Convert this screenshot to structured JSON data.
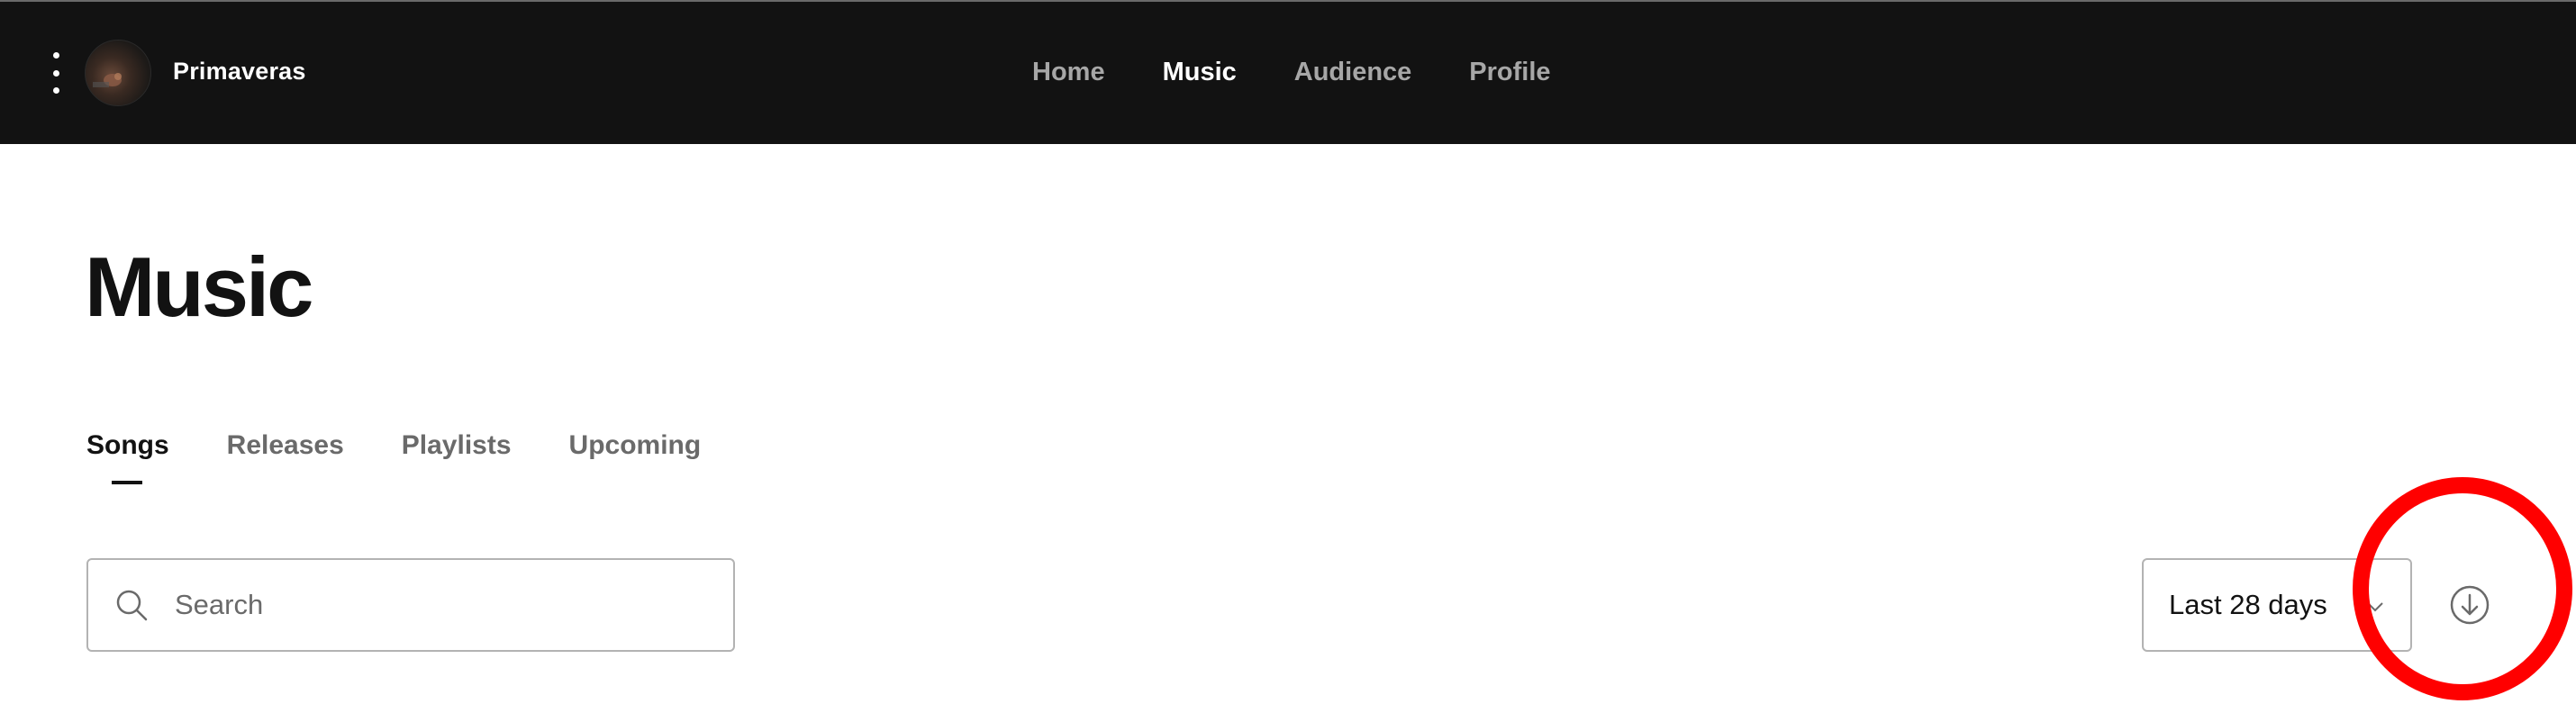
{
  "header": {
    "artist_name": "Primaveras",
    "nav": [
      {
        "label": "Home",
        "active": false
      },
      {
        "label": "Music",
        "active": true
      },
      {
        "label": "Audience",
        "active": false
      },
      {
        "label": "Profile",
        "active": false
      }
    ],
    "icons": {
      "menu": "vertical-dots-icon",
      "avatar": "artist-avatar"
    }
  },
  "page": {
    "title": "Music"
  },
  "tabs": [
    {
      "label": "Songs",
      "active": true
    },
    {
      "label": "Releases",
      "active": false
    },
    {
      "label": "Playlists",
      "active": false
    },
    {
      "label": "Upcoming",
      "active": false
    }
  ],
  "toolbar": {
    "search_placeholder": "Search",
    "search_value": "",
    "date_range": "Last 28 days",
    "icons": {
      "search": "search-icon",
      "date_dropdown": "chevron-down-icon",
      "download": "download-icon"
    }
  },
  "annotation": {
    "color": "#ff0000"
  },
  "colors": {
    "topbar_bg": "#121212",
    "text_primary": "#121212",
    "text_muted": "#6a6a6a",
    "border": "#b3b3b3"
  }
}
